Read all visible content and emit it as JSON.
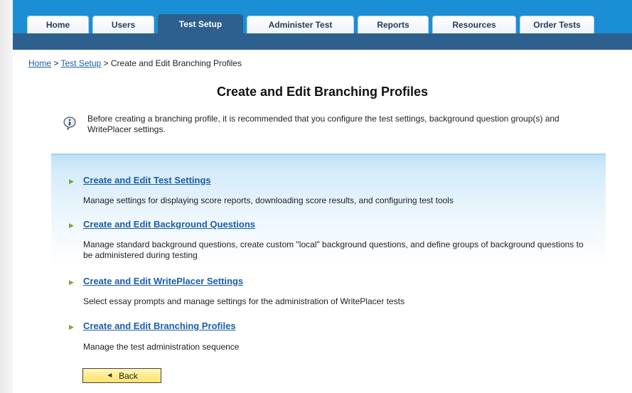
{
  "nav": {
    "tabs": [
      {
        "label": "Home"
      },
      {
        "label": "Users"
      },
      {
        "label": "Test Setup"
      },
      {
        "label": "Administer Test"
      },
      {
        "label": "Reports"
      },
      {
        "label": "Resources"
      },
      {
        "label": "Order Tests"
      }
    ],
    "active_tab": "Test Setup"
  },
  "breadcrumb": {
    "home": "Home",
    "sep1": " > ",
    "test_setup": "Test Setup",
    "sep2": " > ",
    "current": "Create and Edit Branching Profiles"
  },
  "page": {
    "title": "Create and Edit Branching Profiles",
    "info_icon": "info-icon",
    "info_text": "Before creating a branching profile, it is recommended that you configure the test settings, background question group(s) and WritePlacer settings."
  },
  "items": [
    {
      "title": "Create and Edit Test Settings",
      "desc": "Manage settings for displaying score reports, downloading score results, and configuring test tools"
    },
    {
      "title": "Create and Edit Background Questions",
      "desc": "Manage standard background questions, create custom \"local\" background questions, and define groups of background questions to be administered during testing"
    },
    {
      "title": "Create and Edit WritePlacer Settings",
      "desc": "Select essay prompts and manage settings for the administration of WritePlacer tests"
    },
    {
      "title": "Create and Edit Branching Profiles",
      "desc": "Manage the test administration sequence"
    }
  ],
  "back_button": {
    "label": "Back",
    "icon": "back-arrow-icon"
  },
  "colors": {
    "nav_top": "#1a8fd6",
    "nav_bar": "#2d5f8f",
    "link": "#1a5ea8",
    "bullet": "#7aa63a",
    "button": "#ffe26a"
  }
}
